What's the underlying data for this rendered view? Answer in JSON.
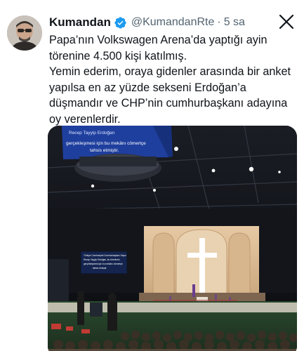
{
  "post": {
    "author_name": "Kumandan",
    "author_handle": "@KumandanRte",
    "separator": "·",
    "timestamp": "5 sa",
    "text": "Papa’nın Volkswagen Arena’da yaptığı ayin\ntörenine 4.500 kişi katılmış.\nYemin ederim, oraya gidenler arasında bir anket\nyapılsa en az yüzde sekseni Erdoğan’a\ndüşmandır ve CHP’nin cumhurbaşkanı adayına\noy verenlerdir."
  },
  "icons": {
    "verified": "verified-badge-icon",
    "close": "close-x-icon"
  },
  "colors": {
    "verified_blue": "#1d9bf0",
    "secondary_text": "#536471",
    "primary_text": "#0f1419"
  },
  "media": {
    "screen_text": {
      "top_line1": "Recep Tayyip Erdoğan",
      "top_line2": "gerçekleşmesi için bu mekânı cömertçe",
      "top_line3": "tahsis etmiştir.",
      "side_line1": "Türkiye Cumhuriyeti Cumhurbaşkanı Sayın",
      "side_line2": "Recep Tayyip Erdoğan, bu törenlerin",
      "side_line3": "gerçekleşmesi için bu mekânı cömertçe",
      "side_line4": "tahsis etmiştir."
    }
  }
}
